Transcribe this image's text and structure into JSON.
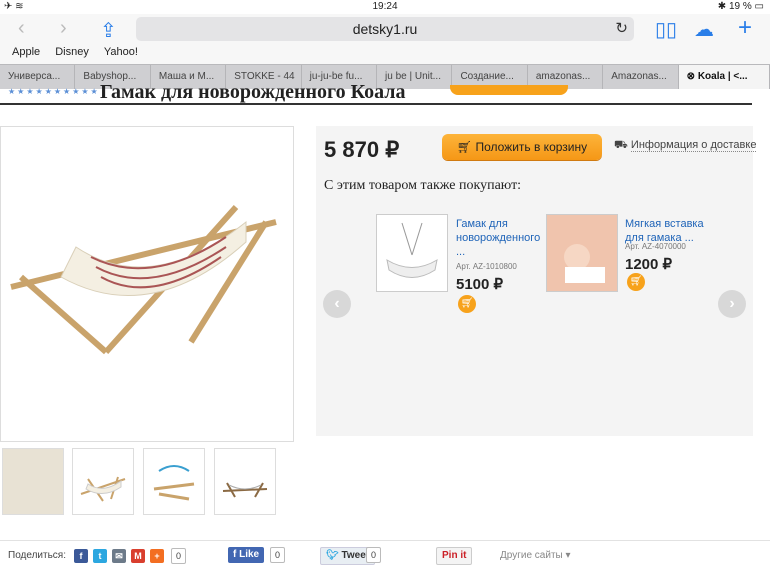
{
  "status": {
    "time": "19:24",
    "battery": "19 %"
  },
  "browser": {
    "url": "detsky1.ru",
    "bookmarks": [
      "Apple",
      "Disney",
      "Yahoo!"
    ],
    "tabs": [
      "Универса...",
      "Babyshop...",
      "Маша и М...",
      "STOKKE - 44",
      "ju-ju-be fu...",
      "ju be | Unit...",
      "Создание...",
      "amazonas...",
      "Amazonas...",
      "Koala | <..."
    ]
  },
  "product": {
    "title": "Гамак для новорожденного Коала",
    "price": "5 870",
    "currency": "₽",
    "cart_label": "Положить в корзину",
    "delivery_label": "Информация о доставке",
    "also_bought": "С этим товаром также покупают:"
  },
  "recommendations": [
    {
      "name1": "Гамак для",
      "name2": "новорожденного",
      "name3": "...",
      "art": "Арт. AZ-1010800",
      "price": "5100 ₽"
    },
    {
      "name1": "Мягкая вставка",
      "name2": "для гамака ...",
      "name3": "",
      "art": "Арт. AZ-4070000",
      "price": "1200 ₽"
    }
  ],
  "share": {
    "label": "Поделиться:",
    "count_main": "0",
    "like_label": "Like",
    "like_count": "0",
    "tweet_label": "Tweet",
    "tweet_count": "0",
    "pin_label": "Pin it",
    "other_label": "Другие сайты"
  },
  "colors": {
    "accent": "#2a7ee8",
    "cart": "#f7a21b",
    "link": "#1f64b8"
  }
}
